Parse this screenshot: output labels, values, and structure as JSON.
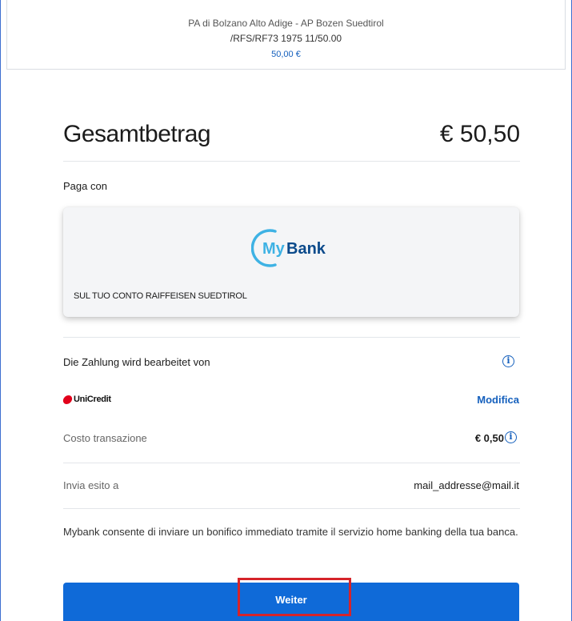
{
  "header": {
    "title": "PA di Bolzano Alto Adige - AP Bozen Suedtirol",
    "reference": "/RFS/RF73 1975 11/50.00",
    "amount": "50,00 €"
  },
  "total": {
    "label": "Gesamtbetrag",
    "value": "€ 50,50"
  },
  "payment": {
    "section_label": "Paga con",
    "card_logo": {
      "text_my": "My",
      "text_bank": "Bank"
    },
    "card_text": "SUL TUO CONTO RAIFFEISEN SUEDTIROL"
  },
  "processor": {
    "label": "Die Zahlung wird bearbeitet von",
    "bank_name": "UniCredit",
    "edit_label": "Modifica"
  },
  "fee": {
    "label": "Costo transazione",
    "value": "€ 0,50"
  },
  "send_result": {
    "label": "Invia esito a",
    "value": "mail_addresse@mail.it"
  },
  "note": "Mybank consente di inviare un bonifico immediato tramite il servizio home banking della tua banca.",
  "primary_button": {
    "label": "Weiter"
  },
  "icons": {
    "info": "info-icon",
    "brand_color": "#1560bd",
    "button_color": "#0f6ad8",
    "highlight_color": "#d6242a"
  }
}
